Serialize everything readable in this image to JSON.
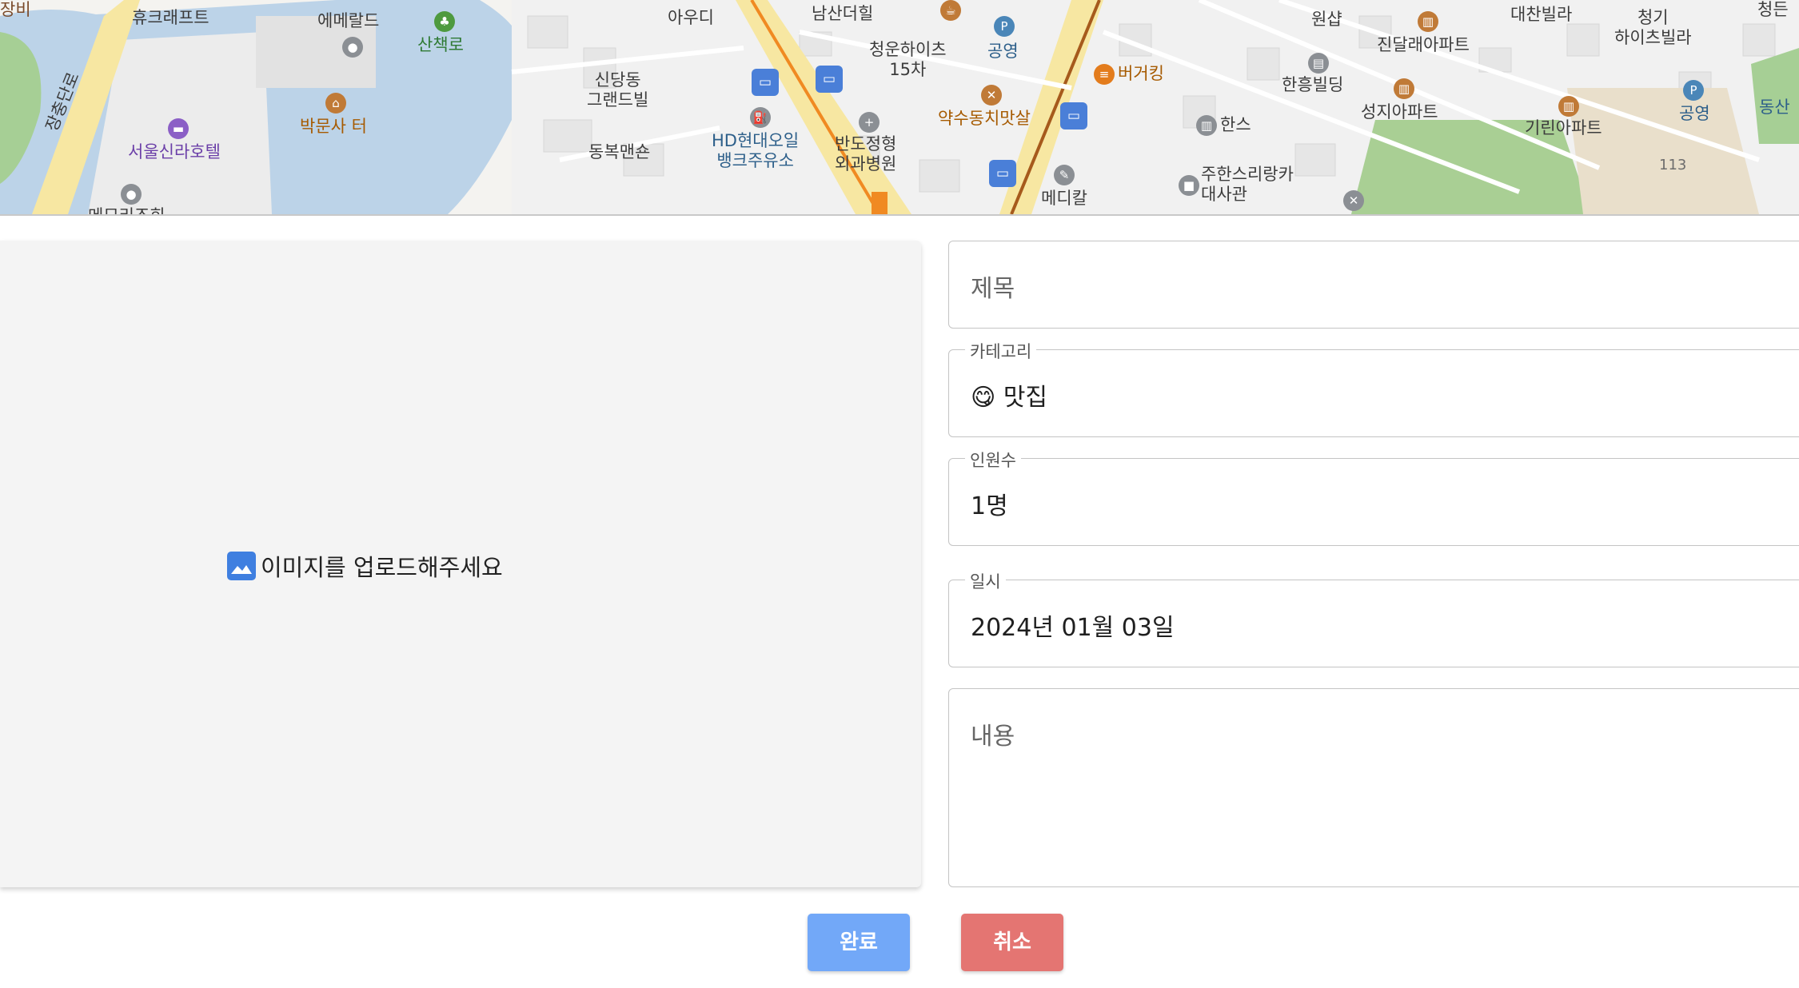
{
  "map": {
    "labels": {
      "hyucraft": "휴크래프트",
      "emerald": "에메랄드",
      "walkway": "산책로",
      "auudi": "아우디",
      "namsan_the_hill": "남산더힐",
      "cheongun_heights": "청운하이츠\n15차",
      "parking1": "공영",
      "sindangdong_grand": "신당동\n그랜드빌",
      "burger_king": "버거킹",
      "wonshop": "원샵",
      "jindallae": "진달래아파트",
      "daechan": "대찬빌라",
      "cheonggi": "청기\n하이츠빌라",
      "hanheung": "한흥빌딩",
      "seongji": "성지아파트",
      "girin": "기린아파트",
      "parking2": "공영",
      "dongsan": "동산",
      "jangchung_road": "장충단로",
      "shilla_hotel": "서울신라호텔",
      "bakmunsa": "박문사 터",
      "yaksu": "약수동치맛살",
      "hansu": "한스",
      "dongbok": "동복맨숀",
      "hd_oilbank": "HD현대오일\n뱅크주유소",
      "bando": "반도정형\n외과병원",
      "medical": "메디칼",
      "tunisia": "주한스리랑카\n대사관",
      "num113": "113",
      "memorial_cut": "메모리조회",
      "partial_left": "장비",
      "partial_right": "청든"
    }
  },
  "upload": {
    "icon": "image-icon",
    "message": "이미지를 업로드해주세요"
  },
  "form": {
    "title_placeholder": "제목",
    "category_label": "카테고리",
    "category_emoji": "😋",
    "category_value": "맛집",
    "people_label": "인원수",
    "people_value": "1명",
    "date_label": "일시",
    "date_value": "2024년 01월 03일",
    "content_placeholder": "내용"
  },
  "buttons": {
    "complete": "완료",
    "cancel": "취소"
  },
  "colors": {
    "complete_button": "#72a8f8",
    "cancel_button": "#e47572",
    "upload_icon": "#3f7fe0"
  }
}
